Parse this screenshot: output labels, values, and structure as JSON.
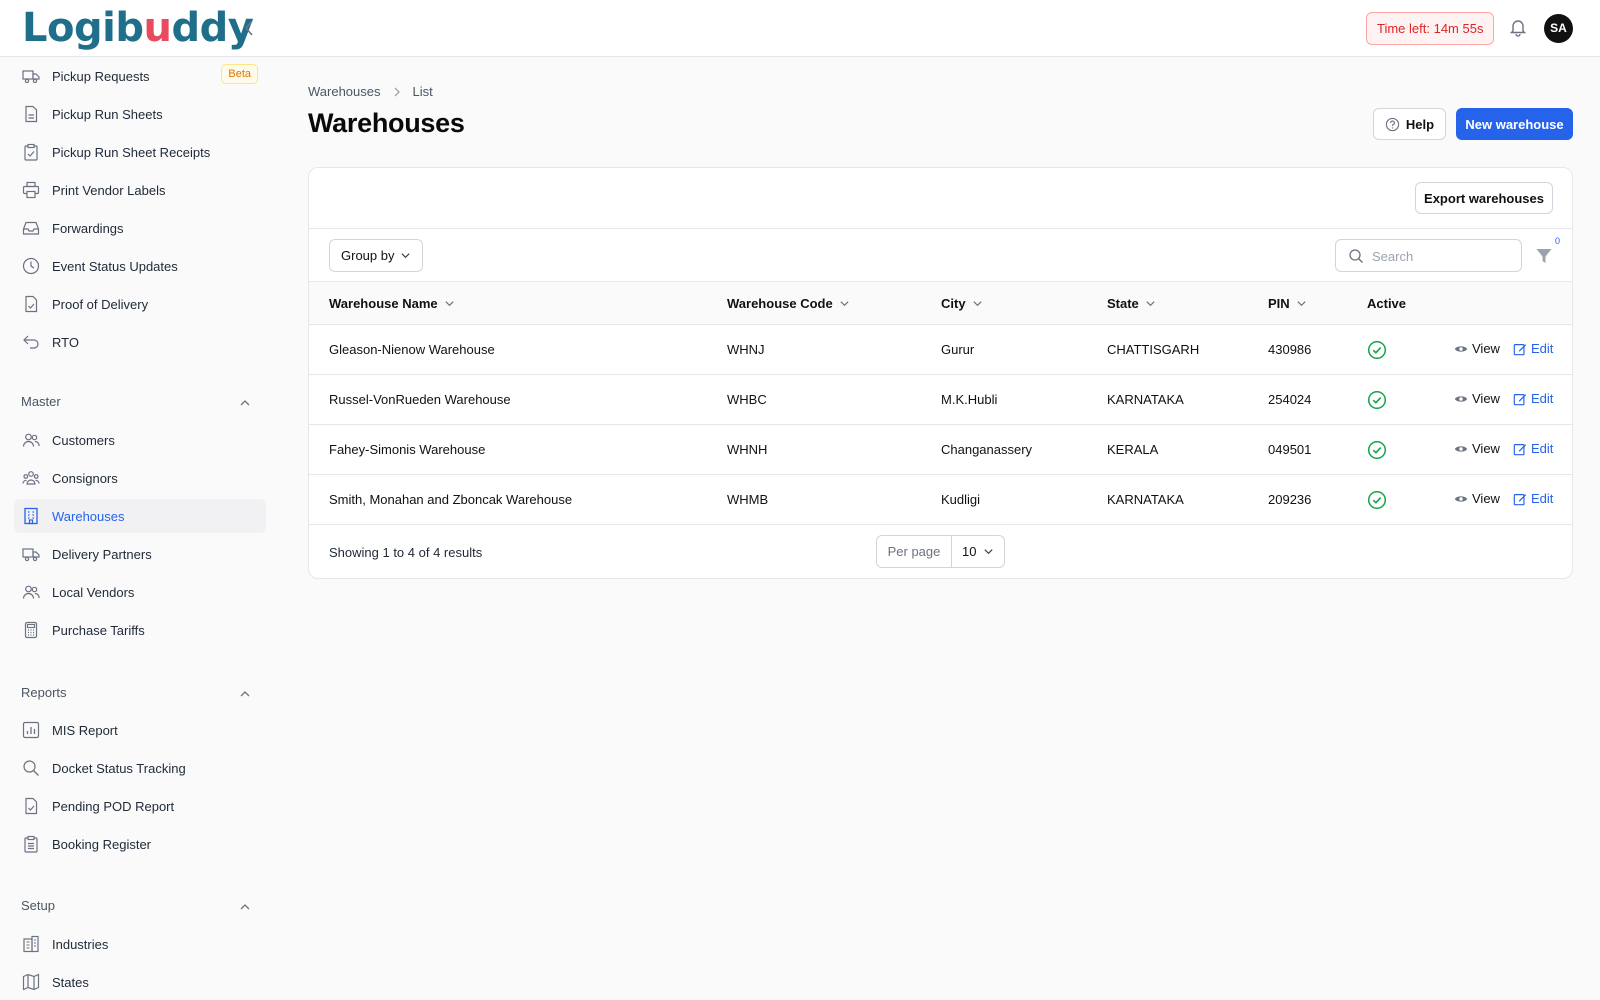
{
  "app": {
    "logo_text": "Logibuddy",
    "timer": "Time left: 14m 55s",
    "avatar": "SA"
  },
  "sidebar": {
    "top_items": [
      {
        "label": "Pickup Requests",
        "badge": "Beta"
      },
      {
        "label": "Pickup Run Sheets"
      },
      {
        "label": "Pickup Run Sheet Receipts"
      },
      {
        "label": "Print Vendor Labels"
      },
      {
        "label": "Forwardings"
      },
      {
        "label": "Event Status Updates"
      },
      {
        "label": "Proof of Delivery"
      },
      {
        "label": "RTO"
      }
    ],
    "master_title": "Master",
    "master_items": [
      {
        "label": "Customers"
      },
      {
        "label": "Consignors"
      },
      {
        "label": "Warehouses",
        "active": true
      },
      {
        "label": "Delivery Partners"
      },
      {
        "label": "Local Vendors"
      },
      {
        "label": "Purchase Tariffs"
      }
    ],
    "reports_title": "Reports",
    "reports_items": [
      {
        "label": "MIS Report"
      },
      {
        "label": "Docket Status Tracking"
      },
      {
        "label": "Pending POD Report"
      },
      {
        "label": "Booking Register"
      }
    ],
    "setup_title": "Setup",
    "setup_items": [
      {
        "label": "Industries"
      },
      {
        "label": "States"
      }
    ]
  },
  "main": {
    "breadcrumb": [
      "Warehouses",
      "List"
    ],
    "title": "Warehouses",
    "help_label": "Help",
    "new_label": "New warehouse",
    "export_label": "Export warehouses",
    "group_by_label": "Group by",
    "search_placeholder": "Search",
    "filter_count": "0",
    "columns": [
      "Warehouse Name",
      "Warehouse Code",
      "City",
      "State",
      "PIN",
      "Active"
    ],
    "rows": [
      {
        "name": "Gleason-Nienow Warehouse",
        "code": "WHNJ",
        "city": "Gurur",
        "state": "CHATTISGARH",
        "pin": "430986",
        "active": true
      },
      {
        "name": "Russel-VonRueden Warehouse",
        "code": "WHBC",
        "city": "M.K.Hubli",
        "state": "KARNATAKA",
        "pin": "254024",
        "active": true
      },
      {
        "name": "Fahey-Simonis Warehouse",
        "code": "WHNH",
        "city": "Changanassery",
        "state": "KERALA",
        "pin": "049501",
        "active": true
      },
      {
        "name": "Smith, Monahan and Zboncak Warehouse",
        "code": "WHMB",
        "city": "Kudligi",
        "state": "KARNATAKA",
        "pin": "209236",
        "active": true
      }
    ],
    "view_label": "View",
    "edit_label": "Edit",
    "showing_text": "Showing 1 to 4 of 4 results",
    "per_page_label": "Per page",
    "per_page_value": "10"
  },
  "colors": {
    "accent": "#2563eb",
    "active_check": "#16a34a",
    "timer_text": "#dc2626",
    "beta_text": "#d97706"
  }
}
